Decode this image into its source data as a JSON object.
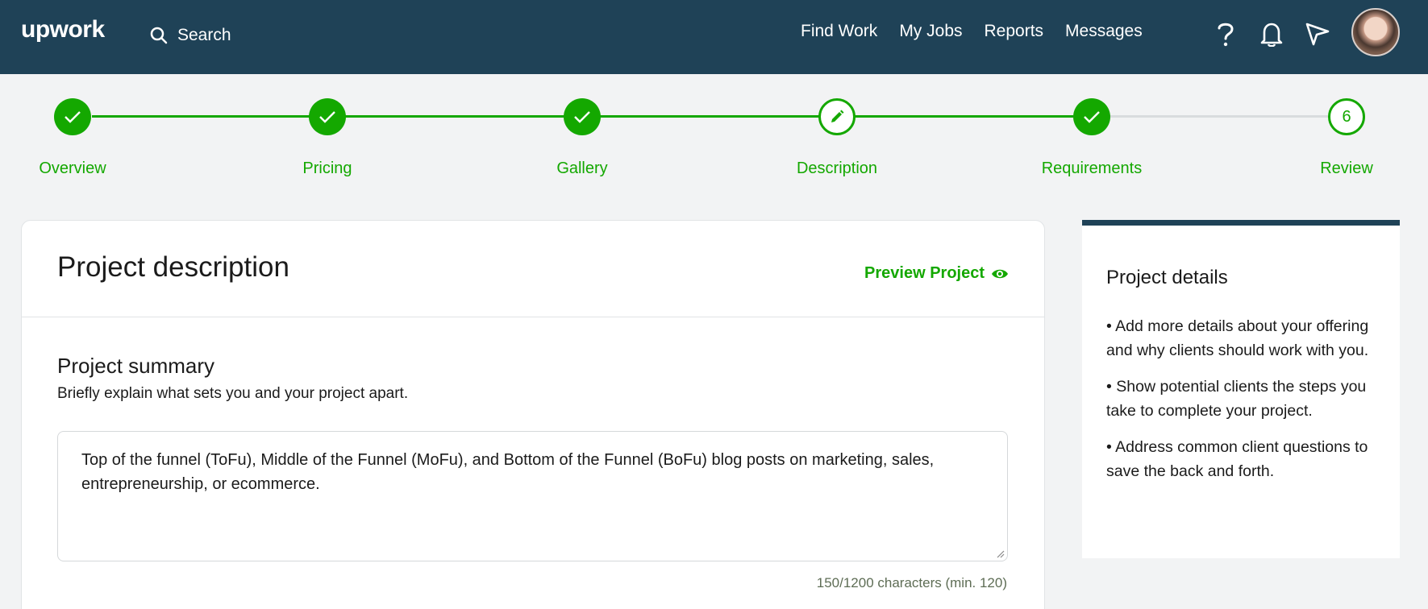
{
  "header": {
    "logo": "upwork",
    "search_label": "Search",
    "nav": [
      "Find Work",
      "My Jobs",
      "Reports",
      "Messages"
    ],
    "icons": [
      "help-icon",
      "bell-icon",
      "send-icon"
    ]
  },
  "stepper": {
    "steps": [
      {
        "label": "Overview",
        "state": "done"
      },
      {
        "label": "Pricing",
        "state": "done"
      },
      {
        "label": "Gallery",
        "state": "done"
      },
      {
        "label": "Description",
        "state": "current"
      },
      {
        "label": "Requirements",
        "state": "done"
      },
      {
        "label": "Review",
        "state": "pending",
        "number": "6"
      }
    ]
  },
  "main": {
    "title": "Project description",
    "preview_label": "Preview Project",
    "summary_title": "Project summary",
    "summary_sub": "Briefly explain what sets you and your project apart.",
    "summary_value": "Top of the funnel (ToFu), Middle of the Funnel (MoFu), and Bottom of the Funnel (BoFu) blog posts on marketing, sales, entrepreneurship, or ecommerce.",
    "counter": "150/1200 characters (min. 120)"
  },
  "side": {
    "title": "Project details",
    "tips": [
      "• Add more details about your offering and why clients should work with you.",
      "• Show potential clients the steps you take to complete your project.",
      "• Address common client questions to save the back and forth."
    ]
  },
  "colors": {
    "header_bg": "#1f4257",
    "accent": "#14a800",
    "page_bg": "#f2f3f4"
  }
}
